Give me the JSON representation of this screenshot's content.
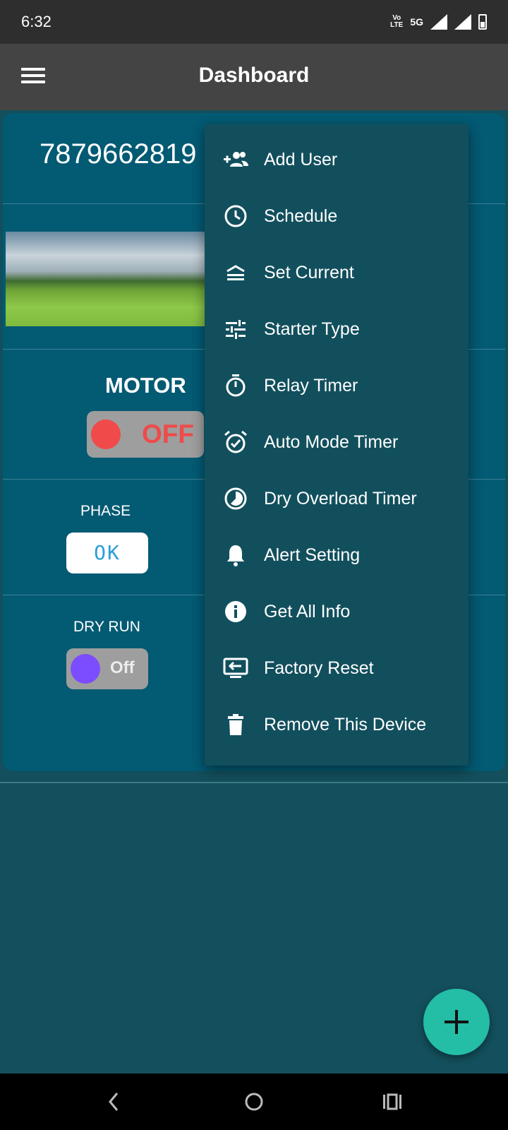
{
  "status_bar": {
    "time": "6:32",
    "volte_top": "Vo",
    "volte_bottom": "LTE",
    "network": "5G"
  },
  "app_bar": {
    "title": "Dashboard",
    "menu_icon": "hamburger-menu-icon"
  },
  "device": {
    "phone_number": "7879662819",
    "motor_label": "MOTOR",
    "motor_state": "OFF",
    "phase_label": "PHASE",
    "phase_value": "OK",
    "dry_run_label": "DRY RUN",
    "dry_run_state": "Off"
  },
  "popup_menu": {
    "items": [
      {
        "label": "Add User",
        "icon": "add-user-icon"
      },
      {
        "label": "Schedule",
        "icon": "clock-icon"
      },
      {
        "label": "Set Current",
        "icon": "current-icon"
      },
      {
        "label": "Starter Type",
        "icon": "tune-icon"
      },
      {
        "label": "Relay Timer",
        "icon": "timer-icon"
      },
      {
        "label": "Auto Mode Timer",
        "icon": "alarm-icon"
      },
      {
        "label": "Dry Overload Timer",
        "icon": "pie-timer-icon"
      },
      {
        "label": "Alert Setting",
        "icon": "bell-icon"
      },
      {
        "label": "Get All Info",
        "icon": "info-icon"
      },
      {
        "label": "Factory Reset",
        "icon": "reset-screen-icon"
      },
      {
        "label": "Remove This Device",
        "icon": "trash-icon"
      }
    ]
  },
  "fab": {
    "icon": "plus-icon"
  },
  "nav_bar": {
    "back": "back-icon",
    "home": "home-icon",
    "recents": "recents-icon"
  },
  "colors": {
    "card": "#035a73",
    "background": "#134f5c",
    "menu": "#124f5d",
    "fab": "#24bda5",
    "motor_off": "#f04a4a",
    "dry_run_knob": "#7c4dff"
  }
}
